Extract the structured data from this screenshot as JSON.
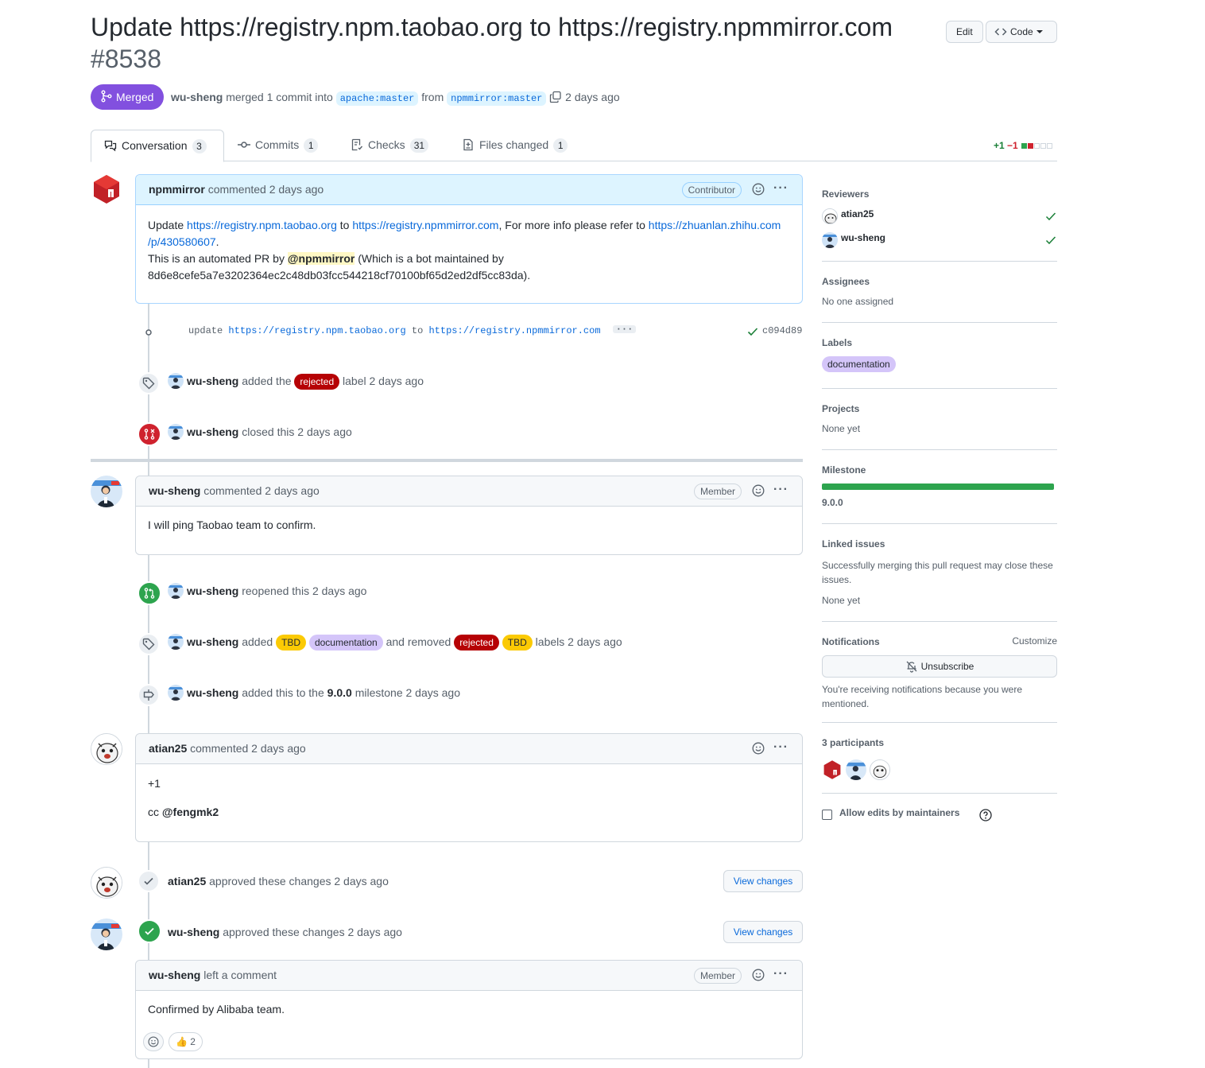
{
  "header": {
    "title": "Update https://registry.npm.taobao.org to https://registry.npmmirror.com",
    "number": "#8538",
    "edit_label": "Edit",
    "code_label": "Code",
    "state": "Merged",
    "author": "wu-sheng",
    "merge_text": "merged 1 commit into",
    "base_branch": "apache:master",
    "from_text": "from",
    "head_branch": "npmmirror:master",
    "time": "2 days ago"
  },
  "tabs": [
    {
      "label": "Conversation",
      "count": "3"
    },
    {
      "label": "Commits",
      "count": "1"
    },
    {
      "label": "Checks",
      "count": "31"
    },
    {
      "label": "Files changed",
      "count": "1"
    }
  ],
  "diffstat": {
    "additions": "+1",
    "deletions": "−1",
    "colors": {
      "add": "#2da44e",
      "del": "#cf222e",
      "neutral": "#d0d7de"
    }
  },
  "timeline": {
    "first_comment": {
      "author": "npmmirror",
      "action": "commented 2 days ago",
      "role": "Contributor",
      "line1_a": "Update ",
      "link1": "https://registry.npm.taobao.org",
      "line1_b": " to ",
      "link2": "https://registry.npmmirror.com",
      "line1_c": ", For more info please refer to ",
      "link3a": "https://zhuanlan.zhihu.com",
      "link3b": "/p/430580607",
      "line1_d": ".",
      "line2_a": "This is an automated PR by ",
      "mention": "@npmmirror",
      "line2_b": " (Which is a bot maintained by",
      "line3": "8d6e8cefe5a7e3202364ec2c48db03fcc544218cf70100bf65d2ed2df5cc83da)."
    },
    "commit": {
      "msg_a": "update ",
      "link1": "https://registry.npm.taobao.org",
      "msg_b": " to ",
      "link2": "https://registry.npmmirror.com",
      "sha": "c094d89"
    },
    "event_label": {
      "user": "wu-sheng",
      "text_a": "added the",
      "label": "rejected",
      "text_b": "label 2 days ago"
    },
    "event_closed": {
      "user": "wu-sheng",
      "text": "closed this 2 days ago"
    },
    "comment2": {
      "author": "wu-sheng",
      "action": "commented 2 days ago",
      "role": "Member",
      "body": "I will ping Taobao team to confirm."
    },
    "event_reopen": {
      "user": "wu-sheng",
      "text": "reopened this 2 days ago"
    },
    "event_labels2": {
      "user": "wu-sheng",
      "text_a": "added",
      "added": [
        "TBD",
        "documentation"
      ],
      "text_b": "and removed",
      "removed": [
        "rejected",
        "TBD"
      ],
      "text_c": "labels 2 days ago"
    },
    "event_milestone": {
      "user": "wu-sheng",
      "text_a": "added this to the",
      "milestone": "9.0.0",
      "text_b": "milestone 2 days ago"
    },
    "comment3": {
      "author": "atian25",
      "action": "commented 2 days ago",
      "body1": "+1",
      "body2_a": "cc ",
      "mention": "@fengmk2"
    },
    "review1": {
      "user": "atian25",
      "text": "approved these changes 2 days ago",
      "button": "View changes"
    },
    "review2": {
      "user": "wu-sheng",
      "text": "approved these changes 2 days ago",
      "button": "View changes"
    },
    "comment4": {
      "author": "wu-sheng",
      "action": "left a comment",
      "role": "Member",
      "body": "Confirmed by Alibaba team.",
      "reaction_emoji": "👍",
      "reaction_count": "2"
    }
  },
  "sidebar": {
    "reviewers": {
      "title": "Reviewers",
      "items": [
        "atian25",
        "wu-sheng"
      ]
    },
    "assignees": {
      "title": "Assignees",
      "value": "No one assigned"
    },
    "labels": {
      "title": "Labels",
      "items": [
        "documentation"
      ]
    },
    "projects": {
      "title": "Projects",
      "value": "None yet"
    },
    "milestone": {
      "title": "Milestone",
      "name": "9.0.0",
      "progress": 1.0
    },
    "linked": {
      "title": "Linked issues",
      "desc": "Successfully merging this pull request may close these issues.",
      "value": "None yet"
    },
    "notifications": {
      "title": "Notifications",
      "customize": "Customize",
      "button": "Unsubscribe",
      "desc": "You're receiving notifications because you were mentioned."
    },
    "participants": {
      "title": "3 participants"
    },
    "allow_edits": "Allow edits by maintainers"
  }
}
